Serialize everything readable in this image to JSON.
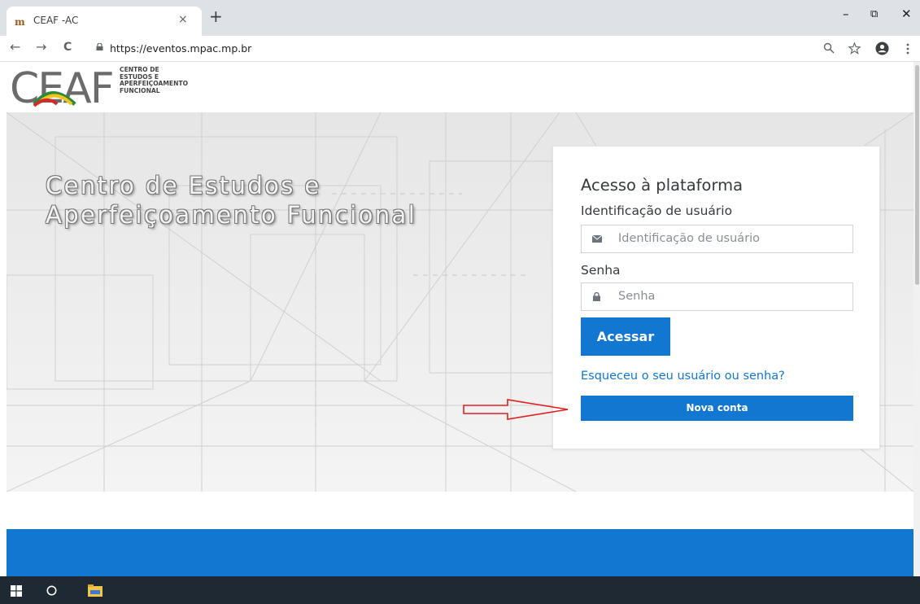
{
  "browser": {
    "tab_title": "CEAF -AC",
    "tab_close": "×",
    "new_tab": "+",
    "url": "https://eventos.mpac.mp.br",
    "window_minimize": "–",
    "window_restore": "⧉",
    "window_close": "✕",
    "nav_back": "←",
    "nav_forward": "→",
    "nav_reload": "C"
  },
  "header": {
    "logo_letters": "CEAF",
    "logo_lines": [
      "CENTRO DE",
      "ESTUDOS E",
      "APERFEIÇOAMENTO",
      "FUNCIONAL"
    ]
  },
  "hero": {
    "title_line1": "Centro de Estudos e",
    "title_line2": "Aperfeiçoamento Funcional"
  },
  "login": {
    "title": "Acesso à plataforma",
    "username_label": "Identificação de usuário",
    "username_placeholder": "Identificação de usuário",
    "password_label": "Senha",
    "password_placeholder": "Senha",
    "submit_label": "Acessar",
    "forgot_link": "Esqueceu o seu usuário ou senha?",
    "new_account_label": "Nova conta"
  },
  "colors": {
    "primary": "#1177d1",
    "hero_bg": "#ececec",
    "annotation_arrow": "#e02020",
    "taskbar": "#1f2933"
  },
  "icons": {
    "username_addon": "envelope-icon",
    "password_addon": "lock-icon"
  }
}
